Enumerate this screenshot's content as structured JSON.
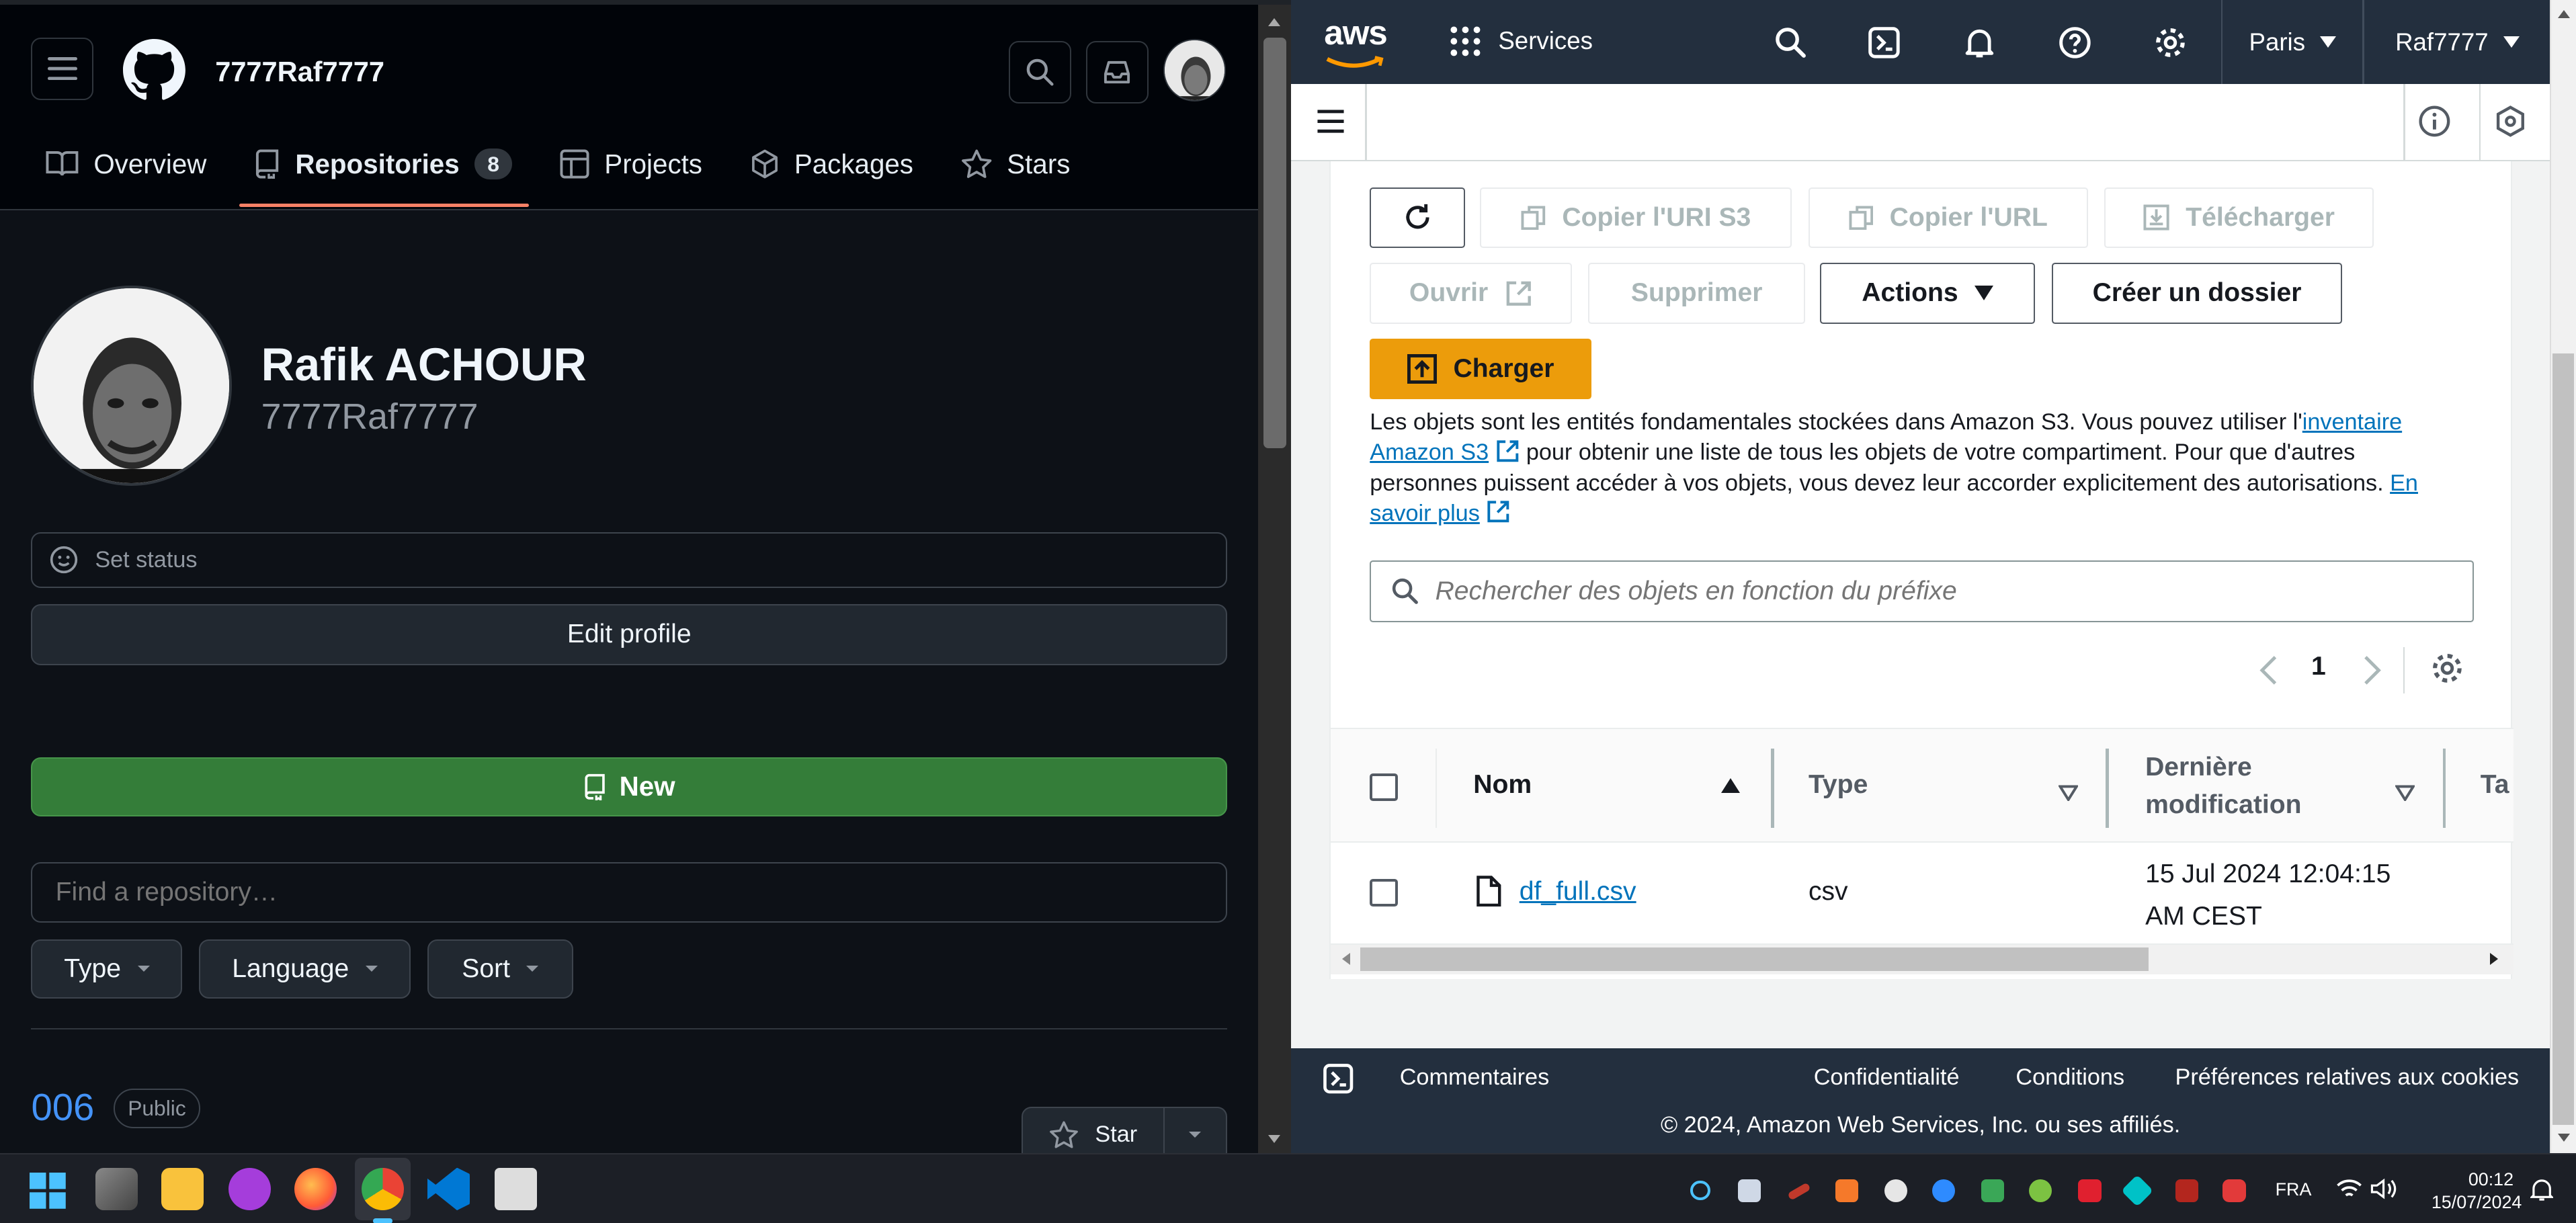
{
  "github": {
    "username": "7777Raf7777",
    "tabs": [
      {
        "label": "Overview",
        "icon": "book-icon"
      },
      {
        "label": "Repositories",
        "icon": "repo-icon",
        "count": "8"
      },
      {
        "label": "Projects",
        "icon": "table-icon"
      },
      {
        "label": "Packages",
        "icon": "package-icon"
      },
      {
        "label": "Stars",
        "icon": "star-icon"
      }
    ],
    "profile": {
      "full_name": "Rafik ACHOUR",
      "login": "7777Raf7777",
      "set_status": "Set status",
      "edit_profile": "Edit profile"
    },
    "new_button": "New",
    "find_placeholder": "Find a repository…",
    "filters": {
      "type": "Type",
      "language": "Language",
      "sort": "Sort"
    },
    "repo": {
      "name": "006",
      "visibility": "Public",
      "star": "Star"
    },
    "colors": {
      "bg": "#0d1117",
      "header_bg": "#010409",
      "accent_underline": "#f78166",
      "new_button": "#347d39",
      "link": "#4493f8"
    }
  },
  "aws": {
    "services": "Services",
    "region": "Paris",
    "account": "Raf7777",
    "toolbar": {
      "copy_uri": "Copier l'URI S3",
      "copy_url": "Copier l'URL",
      "download": "Télécharger",
      "open": "Ouvrir",
      "delete": "Supprimer",
      "actions": "Actions",
      "create_folder": "Créer un dossier",
      "upload": "Charger"
    },
    "info_text": {
      "part1": "Les objets sont les entités fondamentales stockées dans Amazon S3. Vous pouvez utiliser l'",
      "link1": "inventaire Amazon S3",
      "part2": " pour obtenir une liste de tous les objets de votre compartiment. Pour que d'autres personnes puissent accéder à vos objets, vous devez leur accorder explicitement des autorisations. ",
      "link2": "En savoir plus"
    },
    "search_placeholder": "Rechercher des objets en fonction du préfixe",
    "pagination": {
      "page": "1"
    },
    "table": {
      "columns": {
        "name": "Nom",
        "type": "Type",
        "modified": "Dernière modification",
        "size": "Ta"
      },
      "rows": [
        {
          "name": "df_full.csv",
          "type": "csv",
          "modified": "15 Jul 2024 12:04:15 AM CEST"
        }
      ]
    },
    "footer": {
      "comments": "Commentaires",
      "privacy": "Confidentialité",
      "terms": "Conditions",
      "cookies": "Préférences relatives aux cookies",
      "copyright": "© 2024, Amazon Web Services, Inc. ou ses affiliés."
    },
    "colors": {
      "header_bg": "#232f3e",
      "upload": "#ec7211",
      "link": "#0073bb"
    }
  },
  "taskbar": {
    "language": "FRA",
    "time": "00:12",
    "date": "15/07/2024"
  }
}
